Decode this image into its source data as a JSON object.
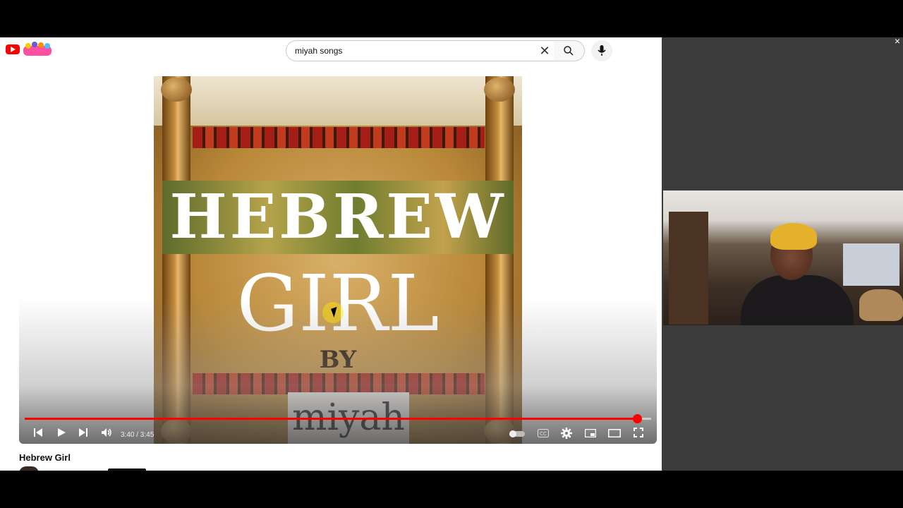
{
  "header": {
    "search_query": "miyah songs"
  },
  "icons": {
    "youtube_logo": "youtube-logo-icon",
    "kids_logo": "youtube-kids-logo-icon",
    "clear": "close-icon",
    "search": "search-icon",
    "mic": "mic-icon"
  },
  "player": {
    "art_title": "HEBREW",
    "art_subtitle": "GIRL",
    "art_by": "BY",
    "art_logo": "miyah",
    "time_display": "3:40 / 3:45",
    "progress": 0.977,
    "colors": {
      "progress": "#ff0000",
      "brand": "#ff0000"
    }
  },
  "video": {
    "title": "Hebrew Girl"
  },
  "side_panel": {
    "close_symbol": "×"
  }
}
